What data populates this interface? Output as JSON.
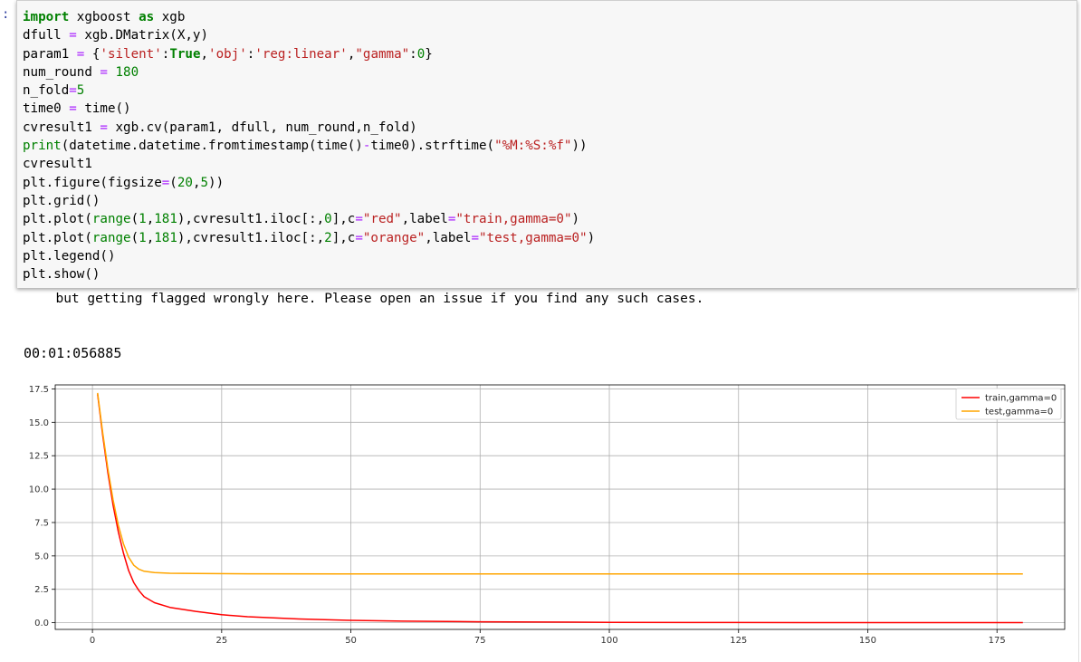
{
  "prompt": ":",
  "code_lines": [
    "import xgboost as xgb",
    "dfull = xgb.DMatrix(X,y)",
    "param1 = {'silent':True,'obj':'reg:linear',\"gamma\":0}",
    "num_round = 180",
    "n_fold=5",
    "time0 = time()",
    "cvresult1 = xgb.cv(param1, dfull, num_round,n_fold)",
    "print(datetime.datetime.fromtimestamp(time()-time0).strftime(\"%M:%S:%f\"))",
    "cvresult1",
    "plt.figure(figsize=(20,5))",
    "plt.grid()",
    "plt.plot(range(1,181),cvresult1.iloc[:,0],c=\"red\",label=\"train,gamma=0\")",
    "plt.plot(range(1,181),cvresult1.iloc[:,2],c=\"orange\",label=\"test,gamma=0\")",
    "plt.legend()",
    "plt.show()"
  ],
  "output": {
    "warning_text": "  but getting flagged wrongly here. Please open an issue if you find any such cases.",
    "elapsed_time": "00:01:056885"
  },
  "chart_data": {
    "type": "line",
    "xlim": [
      1,
      180
    ],
    "ylim": [
      -0.5,
      17.8
    ],
    "x_ticks": [
      0,
      25,
      50,
      75,
      100,
      125,
      150,
      175
    ],
    "y_ticks": [
      0.0,
      2.5,
      5.0,
      7.5,
      10.0,
      12.5,
      15.0,
      17.5
    ],
    "y_tick_labels": [
      "0.0",
      "2.5",
      "5.0",
      "7.5",
      "10.0",
      "12.5",
      "15.0",
      "17.5"
    ],
    "grid": true,
    "legend_position": "top-right",
    "series": [
      {
        "name": "train,gamma=0",
        "color": "#ff0000",
        "points": [
          [
            1,
            17.1
          ],
          [
            2,
            14.0
          ],
          [
            3,
            11.2
          ],
          [
            4,
            8.8
          ],
          [
            5,
            6.8
          ],
          [
            6,
            5.2
          ],
          [
            7,
            3.9
          ],
          [
            8,
            3.0
          ],
          [
            9,
            2.4
          ],
          [
            10,
            1.95
          ],
          [
            12,
            1.5
          ],
          [
            15,
            1.15
          ],
          [
            20,
            0.85
          ],
          [
            25,
            0.6
          ],
          [
            30,
            0.45
          ],
          [
            40,
            0.28
          ],
          [
            50,
            0.18
          ],
          [
            60,
            0.12
          ],
          [
            75,
            0.07
          ],
          [
            100,
            0.03
          ],
          [
            125,
            0.015
          ],
          [
            150,
            0.01
          ],
          [
            180,
            0.005
          ]
        ]
      },
      {
        "name": "test,gamma=0",
        "color": "#ffa500",
        "points": [
          [
            1,
            17.2
          ],
          [
            2,
            14.2
          ],
          [
            3,
            11.5
          ],
          [
            4,
            9.2
          ],
          [
            5,
            7.3
          ],
          [
            6,
            5.9
          ],
          [
            7,
            4.9
          ],
          [
            8,
            4.3
          ],
          [
            9,
            4.0
          ],
          [
            10,
            3.85
          ],
          [
            12,
            3.75
          ],
          [
            15,
            3.7
          ],
          [
            20,
            3.68
          ],
          [
            30,
            3.66
          ],
          [
            50,
            3.65
          ],
          [
            100,
            3.65
          ],
          [
            150,
            3.65
          ],
          [
            180,
            3.65
          ]
        ]
      }
    ]
  }
}
